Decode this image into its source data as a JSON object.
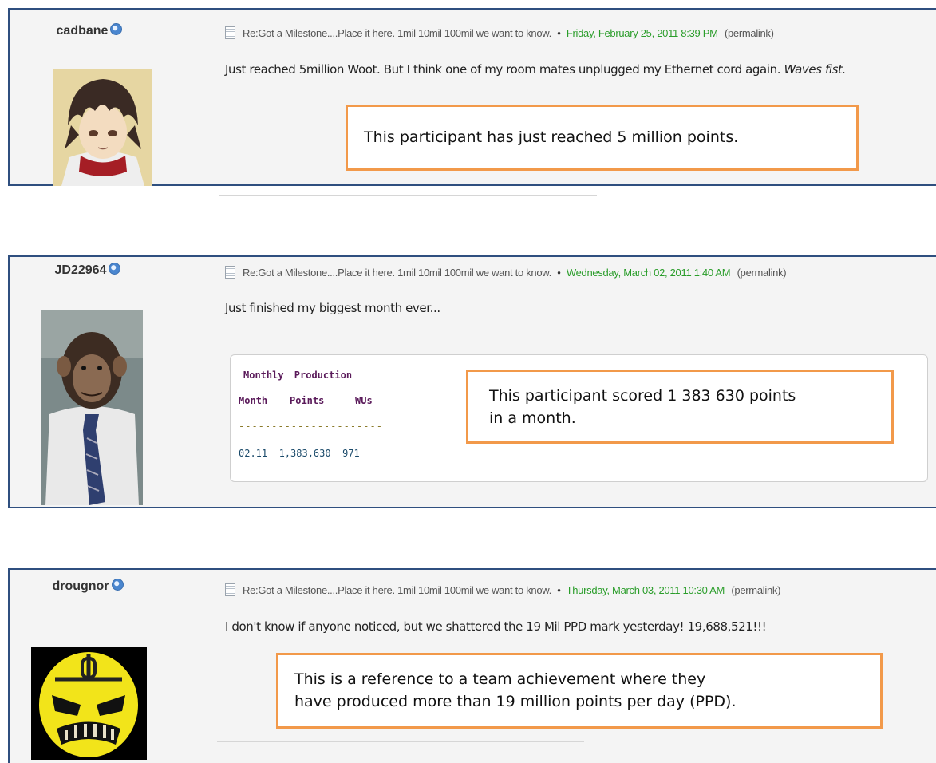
{
  "posts": [
    {
      "username": "cadbane",
      "thread_title": "Re:Got a Milestone....Place it here. 1mil 10mil 100mil we want to know.",
      "bullet": "•",
      "date": "Friday, February 25, 2011 8:39 PM",
      "permalink": "(permalink)",
      "message": "Just reached 5million Woot. But I think one of my room mates unplugged my Ethernet cord again.",
      "message_italic": "Waves fist.",
      "callout": "This participant has just reached 5 million points."
    },
    {
      "username": "JD22964",
      "thread_title": "Re:Got a Milestone....Place it here. 1mil 10mil 100mil we want to know.",
      "bullet": "•",
      "date": "Wednesday, March 02, 2011 1:40 AM",
      "permalink": "(permalink)",
      "message": "Just finished my biggest month ever...",
      "production": {
        "title": "Monthly Production",
        "headers": [
          "Month",
          "Points",
          "WUs"
        ],
        "dashes": "----------------------",
        "row": {
          "month": "02.11",
          "points": "1,383,630",
          "wus": "971"
        }
      },
      "callout_line1": "This participant scored 1 383 630 points",
      "callout_line2": "in a month."
    },
    {
      "username": "drougnor",
      "thread_title": "Re:Got a Milestone....Place it here. 1mil 10mil 100mil we want to know.",
      "bullet": "•",
      "date": "Thursday, March 03, 2011 10:30 AM",
      "permalink": "(permalink)",
      "message": "I don't know if anyone noticed, but we shattered the 19 Mil PPD mark yesterday!  19,688,521!!!",
      "callout_line1": "This is a reference to a team achievement where they",
      "callout_line2": "have produced more than 19 million points per day (PPD)."
    }
  ]
}
